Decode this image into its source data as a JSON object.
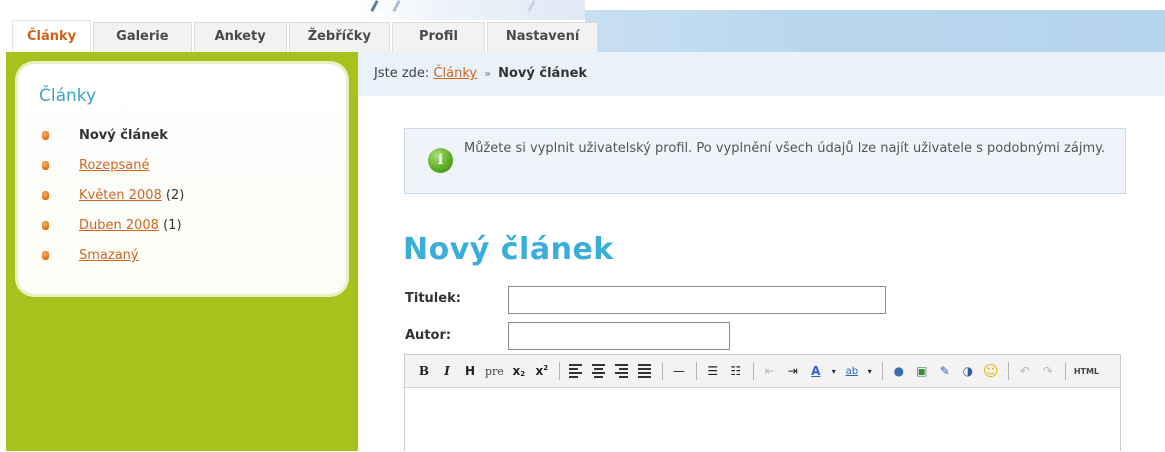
{
  "tabs": [
    {
      "label": "Články",
      "active": true
    },
    {
      "label": "Galerie",
      "active": false
    },
    {
      "label": "Ankety",
      "active": false
    },
    {
      "label": "Žebříčky",
      "active": false
    },
    {
      "label": "Profil",
      "active": false
    },
    {
      "label": "Nastavení",
      "active": false
    }
  ],
  "sidebar": {
    "title": "Články",
    "items": [
      {
        "label": "Nový článek",
        "count": "",
        "current": true
      },
      {
        "label": "Rozepsané",
        "count": "",
        "current": false
      },
      {
        "label": "Květen 2008",
        "count": "(2)",
        "current": false
      },
      {
        "label": "Duben 2008",
        "count": "(1)",
        "current": false
      },
      {
        "label": "Smazaný",
        "count": "",
        "current": false
      }
    ]
  },
  "breadcrumb": {
    "prefix": "Jste zde:",
    "link": "Články",
    "separator": "»",
    "current": "Nový článek"
  },
  "info": {
    "text": "Můžete si vyplnit uživatelský profil. Po vyplnění všech údajů lze najít uživatele s podobnými zájmy."
  },
  "page": {
    "title": "Nový článek"
  },
  "form": {
    "title_label": "Titulek:",
    "title_value": "",
    "author_label": "Autor:",
    "author_value": ""
  },
  "editor": {
    "bold": "B",
    "italic": "I",
    "heading": "H",
    "pre": "pre",
    "subscript": "x",
    "superscript": "x",
    "text_color": "A",
    "highlight": "ab",
    "html": "HTML"
  },
  "colors": {
    "accent_orange": "#d2601a",
    "title_blue": "#3aaed8",
    "sidebar_green": "#a8c21d"
  }
}
